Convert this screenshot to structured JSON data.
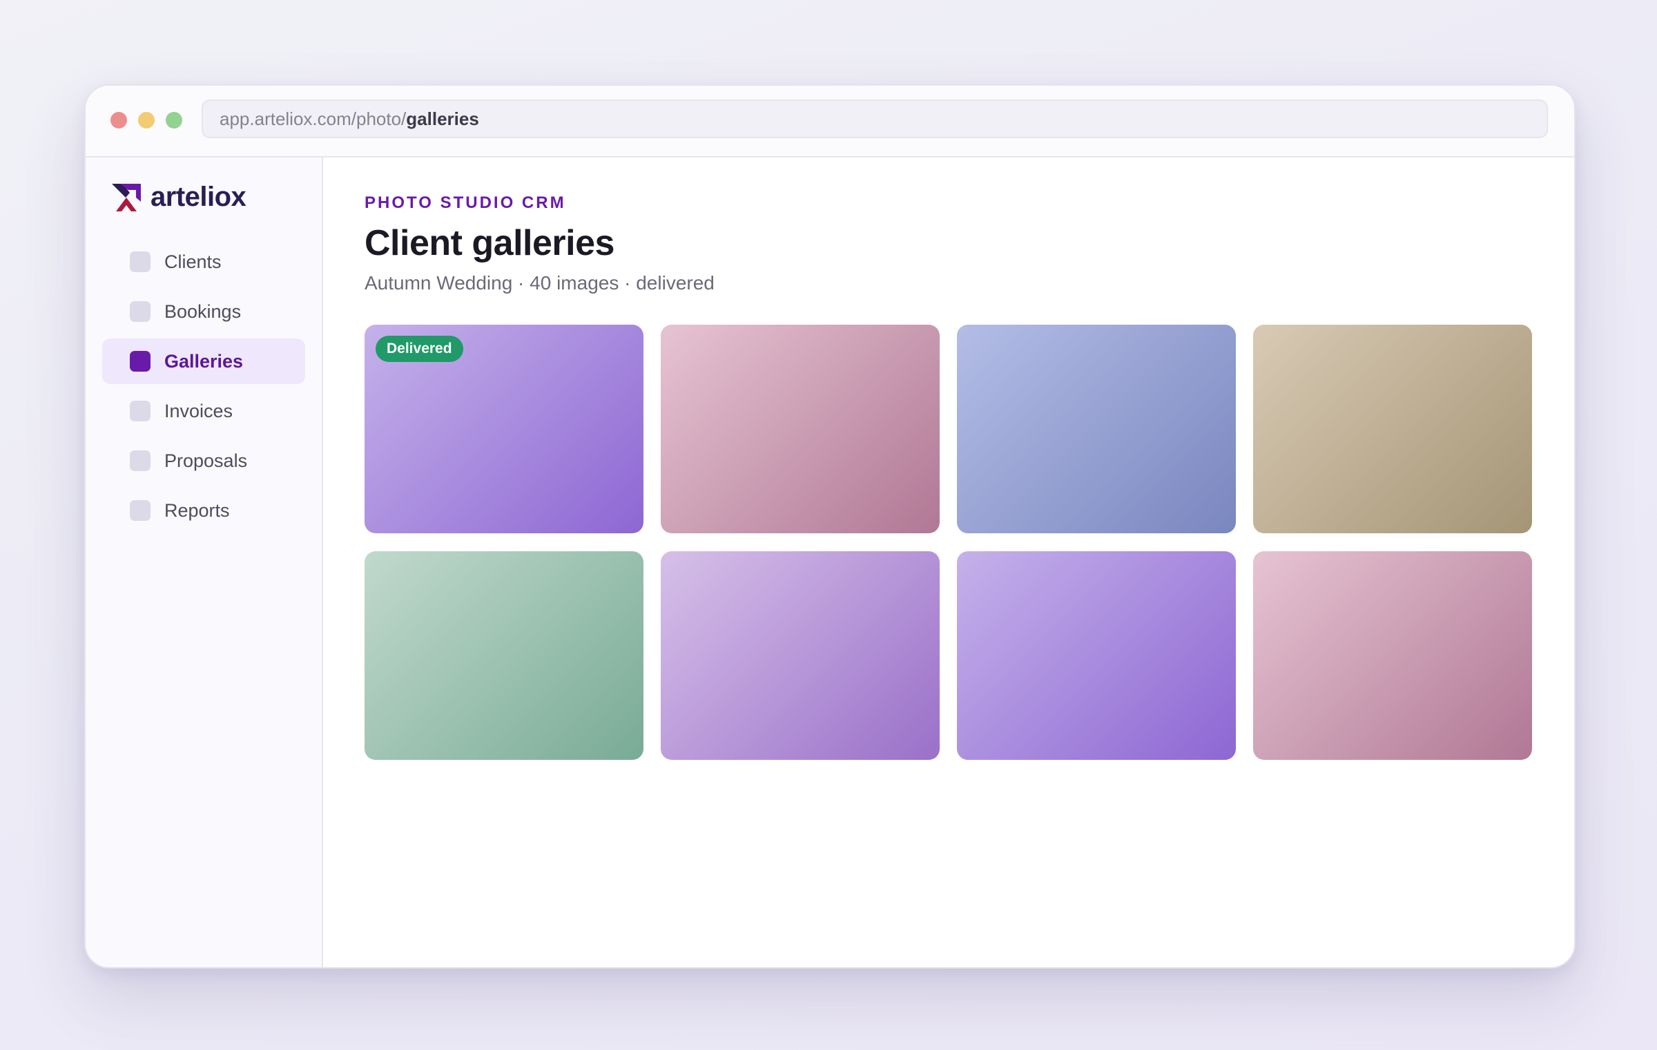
{
  "browser": {
    "url_base": "app.arteliox.com/photo/",
    "url_path": "galleries"
  },
  "brand": {
    "name": "arteliox",
    "logo_icon": "arteliox-logo-mark",
    "color": "#6a1aa9"
  },
  "sidebar": {
    "items": [
      {
        "label": "Clients",
        "active": false
      },
      {
        "label": "Bookings",
        "active": false
      },
      {
        "label": "Galleries",
        "active": true
      },
      {
        "label": "Invoices",
        "active": false
      },
      {
        "label": "Proposals",
        "active": false
      },
      {
        "label": "Reports",
        "active": false
      }
    ]
  },
  "main": {
    "eyebrow": "PHOTO STUDIO CRM",
    "title": "Client galleries",
    "subtitle": "Autumn Wedding · 40 images · delivered"
  },
  "gallery": {
    "tiles": [
      {
        "color": "violet",
        "badge": "Delivered"
      },
      {
        "color": "rose"
      },
      {
        "color": "indigo"
      },
      {
        "color": "sand"
      },
      {
        "color": "sage"
      },
      {
        "color": "lavender"
      },
      {
        "color": "violet"
      },
      {
        "color": "rose"
      }
    ]
  },
  "colors": {
    "accent": "#6a1aa9",
    "active_nav_bg": "#efe7fb",
    "delivered_badge": "#1f9a68"
  }
}
